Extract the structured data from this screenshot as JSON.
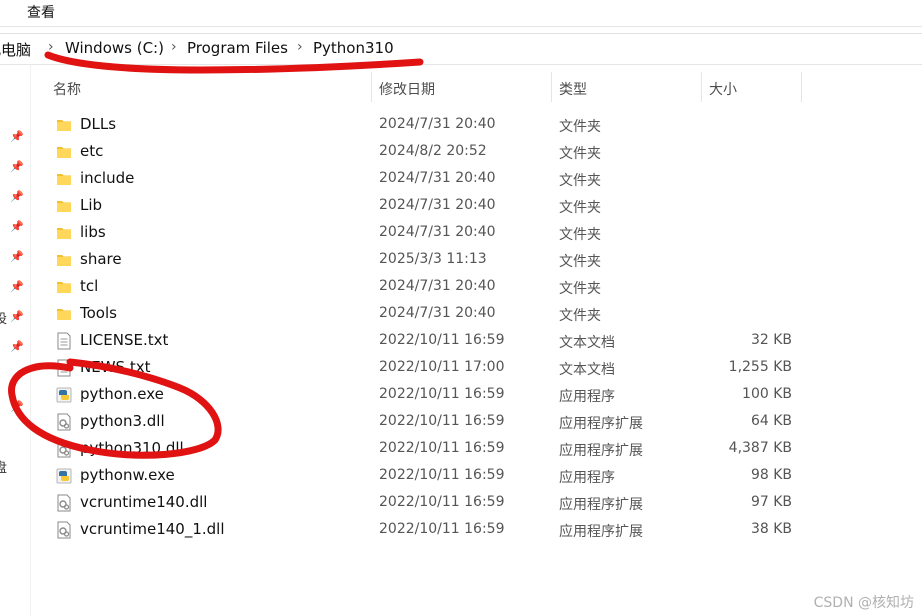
{
  "menu": {
    "view_label": "查看"
  },
  "breadcrumb": {
    "items": [
      "此电脑",
      "Windows (C:)",
      "Program Files",
      "Python310"
    ],
    "separator": "›"
  },
  "columns": {
    "name": "名称",
    "date": "修改日期",
    "type": "类型",
    "size": "大小"
  },
  "nav_fragments": [
    "设",
    "盘"
  ],
  "files": [
    {
      "name": "DLLs",
      "date": "2024/7/31 20:40",
      "type": "文件夹",
      "size": "",
      "icon": "folder-icon"
    },
    {
      "name": "etc",
      "date": "2024/8/2 20:52",
      "type": "文件夹",
      "size": "",
      "icon": "folder-icon"
    },
    {
      "name": "include",
      "date": "2024/7/31 20:40",
      "type": "文件夹",
      "size": "",
      "icon": "folder-icon"
    },
    {
      "name": "Lib",
      "date": "2024/7/31 20:40",
      "type": "文件夹",
      "size": "",
      "icon": "folder-icon"
    },
    {
      "name": "libs",
      "date": "2024/7/31 20:40",
      "type": "文件夹",
      "size": "",
      "icon": "folder-icon"
    },
    {
      "name": "share",
      "date": "2025/3/3 11:13",
      "type": "文件夹",
      "size": "",
      "icon": "folder-icon"
    },
    {
      "name": "tcl",
      "date": "2024/7/31 20:40",
      "type": "文件夹",
      "size": "",
      "icon": "folder-icon"
    },
    {
      "name": "Tools",
      "date": "2024/7/31 20:40",
      "type": "文件夹",
      "size": "",
      "icon": "folder-icon"
    },
    {
      "name": "LICENSE.txt",
      "date": "2022/10/11 16:59",
      "type": "文本文档",
      "size": "32 KB",
      "icon": "text-file-icon"
    },
    {
      "name": "NEWS.txt",
      "date": "2022/10/11 17:00",
      "type": "文本文档",
      "size": "1,255 KB",
      "icon": "text-file-icon"
    },
    {
      "name": "python.exe",
      "date": "2022/10/11 16:59",
      "type": "应用程序",
      "size": "100 KB",
      "icon": "python-exe-icon"
    },
    {
      "name": "python3.dll",
      "date": "2022/10/11 16:59",
      "type": "应用程序扩展",
      "size": "64 KB",
      "icon": "dll-file-icon"
    },
    {
      "name": "python310.dll",
      "date": "2022/10/11 16:59",
      "type": "应用程序扩展",
      "size": "4,387 KB",
      "icon": "dll-file-icon"
    },
    {
      "name": "pythonw.exe",
      "date": "2022/10/11 16:59",
      "type": "应用程序",
      "size": "98 KB",
      "icon": "python-exe-icon"
    },
    {
      "name": "vcruntime140.dll",
      "date": "2022/10/11 16:59",
      "type": "应用程序扩展",
      "size": "97 KB",
      "icon": "dll-file-icon"
    },
    {
      "name": "vcruntime140_1.dll",
      "date": "2022/10/11 16:59",
      "type": "应用程序扩展",
      "size": "38 KB",
      "icon": "dll-file-icon"
    }
  ],
  "watermark": "CSDN @核知坊",
  "colors": {
    "folder": "#f4c02a",
    "annotation": "#e01212"
  }
}
